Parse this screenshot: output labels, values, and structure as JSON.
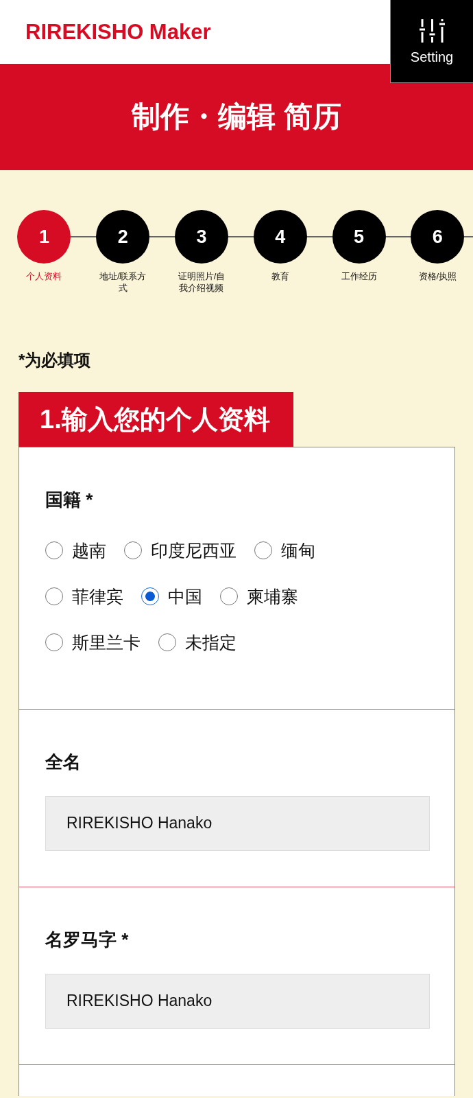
{
  "header": {
    "logo": "RIREKISHO Maker",
    "settings_button": {
      "label": "Setting"
    }
  },
  "banner": {
    "title": "制作・编辑 简历"
  },
  "steps": [
    {
      "number": "1",
      "label": "个人资料",
      "selected": true
    },
    {
      "number": "2",
      "label": "地址/联系方式",
      "selected": false
    },
    {
      "number": "3",
      "label": "证明照片/自我介绍视频",
      "selected": false
    },
    {
      "number": "4",
      "label": "教育",
      "selected": false
    },
    {
      "number": "5",
      "label": "工作经历",
      "selected": false
    },
    {
      "number": "6",
      "label": "资格/执照",
      "selected": false
    }
  ],
  "required_note": "*为必填项",
  "section": {
    "title": "1.输入您的个人资料",
    "fields": [
      {
        "kind": "radio",
        "label": "国籍 *",
        "option_rows": [
          [
            {
              "label": "越南",
              "selected": false
            },
            {
              "label": "印度尼西亚",
              "selected": false
            },
            {
              "label": "缅甸",
              "selected": false
            }
          ],
          [
            {
              "label": "菲律宾",
              "selected": false
            },
            {
              "label": "中国",
              "selected": true
            },
            {
              "label": "柬埔寨",
              "selected": false
            }
          ],
          [
            {
              "label": "斯里兰卡",
              "selected": false
            },
            {
              "label": "未指定",
              "selected": false
            }
          ]
        ]
      },
      {
        "kind": "text",
        "label": "全名",
        "value": "RIREKISHO Hanako"
      },
      {
        "kind": "text",
        "label": "名罗马字 *",
        "value": "RIREKISHO Hanako"
      }
    ]
  }
}
